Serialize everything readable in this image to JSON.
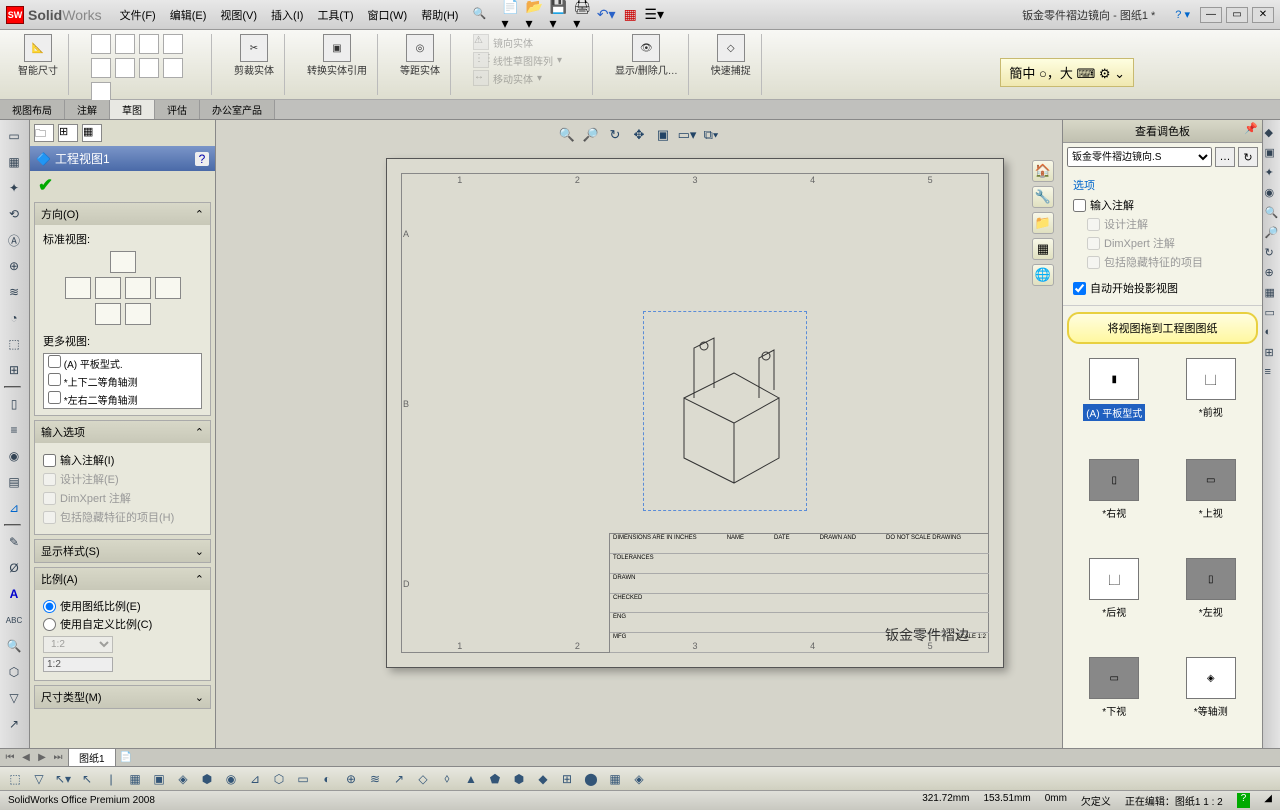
{
  "app": {
    "name_bold": "Solid",
    "name_light": "Works"
  },
  "menu": [
    "文件(F)",
    "编辑(E)",
    "视图(V)",
    "插入(I)",
    "工具(T)",
    "窗口(W)",
    "帮助(H)"
  ],
  "doc_title": "钣金零件褶边镜向 - 图纸1 *",
  "ribbon": {
    "smart_dim": "智能尺寸",
    "trim": "剪裁实体",
    "convert": "转换实体引用",
    "offset": "等距实体",
    "mirror": "镜向实体",
    "linear_pattern": "线性草图阵列",
    "move": "移动实体",
    "show_hide": "显示/删除几…",
    "quick_snap": "快速捕捉"
  },
  "tabs": [
    "视图布局",
    "注解",
    "草图",
    "评估",
    "办公室产品"
  ],
  "ime": "簡中 ○，大 ⌨ ⚙ ⌄",
  "prop": {
    "title": "工程视图1",
    "s1": "方向(O)",
    "std_view": "标准视图:",
    "more_view": "更多视图:",
    "list": [
      "(A) 平板型式.",
      "*上下二等角轴测",
      "*左右二等角轴测"
    ],
    "s2": "输入选项",
    "in_anno": "输入注解(I)",
    "des_anno": "设计注解(E)",
    "dimx": "DimXpert 注解",
    "inc_hidden": "包括隐藏特征的项目(H)",
    "s3": "显示样式(S)",
    "s4": "比例(A)",
    "use_sheet": "使用图纸比例(E)",
    "use_custom": "使用自定义比例(C)",
    "scale_val": "1:2",
    "s5": "尺寸类型(M)"
  },
  "palette": {
    "title": "查看调色板",
    "doc": "钣金零件褶边镜向.S",
    "opts_lbl": "选项",
    "in_anno": "输入注解",
    "des_anno": "设计注解",
    "dimx": "DimXpert 注解",
    "inc_hidden": "包括隐藏特征的项目",
    "auto_proj": "自动开始投影视图",
    "hint": "将视图拖到工程图图纸",
    "views": [
      "(A) 平板型式",
      "*前视",
      "*右视",
      "*上视",
      "*后视",
      "*左视",
      "*下视",
      "*等轴测"
    ]
  },
  "titleblock_name": "钣金零件褶边",
  "sheet_tab": "图纸1",
  "status": {
    "product": "SolidWorks Office Premium 2008",
    "x": "321.72mm",
    "y": "153.51mm",
    "z": "0mm",
    "def": "欠定义",
    "edit": "正在编辑：图纸1  1 : 2"
  }
}
